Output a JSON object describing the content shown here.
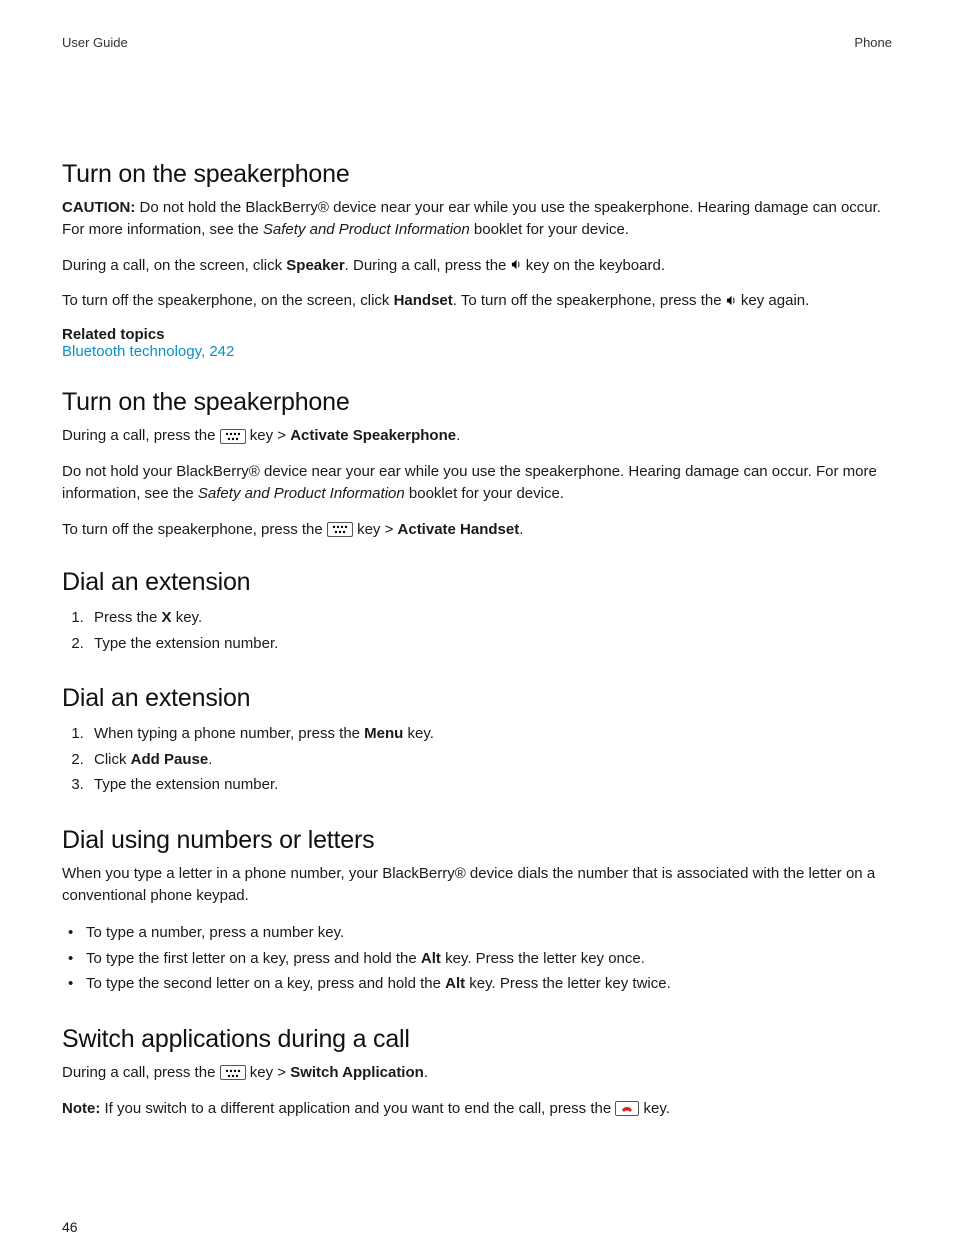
{
  "header": {
    "left": "User Guide",
    "right": "Phone"
  },
  "sec1": {
    "title": "Turn on the speakerphone",
    "caution_label": "CAUTION:",
    "caution_body_a": " Do not hold the BlackBerry® device near your ear while you use the speakerphone. Hearing damage can occur. For more information, see the ",
    "caution_italic": "Safety and Product Information",
    "caution_body_b": " booklet for your device.",
    "line2_a": "During a call, on the screen, click ",
    "line2_speaker": "Speaker",
    "line2_b": ". During a call, press the ",
    "line2_c": " key on the keyboard.",
    "line3_a": "To turn off the speakerphone, on the screen, click ",
    "line3_handset": "Handset",
    "line3_b": ". To turn off the speakerphone, press the ",
    "line3_c": " key again.",
    "related_label": "Related topics",
    "related_link": "Bluetooth technology, 242"
  },
  "sec2": {
    "title": "Turn on the speakerphone",
    "line1_a": "During a call, press the ",
    "line1_b": " key > ",
    "line1_bold": "Activate Speakerphone",
    "line1_c": ".",
    "line2": "Do not hold your BlackBerry® device near your ear while you use the speakerphone. Hearing damage can occur. For more information, see the ",
    "line2_italic": "Safety and Product Information",
    "line2_b": " booklet for your device.",
    "line3_a": "To turn off the speakerphone, press the ",
    "line3_b": " key > ",
    "line3_bold": "Activate Handset",
    "line3_c": "."
  },
  "sec3": {
    "title": "Dial an extension",
    "step1_a": "Press the ",
    "step1_bold": "X",
    "step1_b": " key.",
    "step2": "Type the extension number."
  },
  "sec4": {
    "title": "Dial an extension",
    "step1_a": "When typing a phone number, press the ",
    "step1_bold": "Menu",
    "step1_b": " key.",
    "step2_a": "Click ",
    "step2_bold": "Add Pause",
    "step2_b": ".",
    "step3": "Type the extension number."
  },
  "sec5": {
    "title": "Dial using numbers or letters",
    "intro": "When you type a letter in a phone number, your BlackBerry® device dials the number that is associated with the letter on a conventional phone keypad.",
    "b1": "To type a number, press a number key.",
    "b2_a": "To type the first letter on a key, press and hold the ",
    "b2_bold": "Alt",
    "b2_b": " key. Press the letter key once.",
    "b3_a": "To type the second letter on a key, press and hold the ",
    "b3_bold": "Alt",
    "b3_b": " key. Press the letter key twice."
  },
  "sec6": {
    "title": "Switch applications during a call",
    "line1_a": "During a call, press the ",
    "line1_b": " key > ",
    "line1_bold": "Switch Application",
    "line1_c": ".",
    "note_label": "Note:",
    "note_body_a": " If you switch to a different application and you want to end the call, press the ",
    "note_body_b": " key."
  },
  "footer": {
    "page": "46"
  }
}
